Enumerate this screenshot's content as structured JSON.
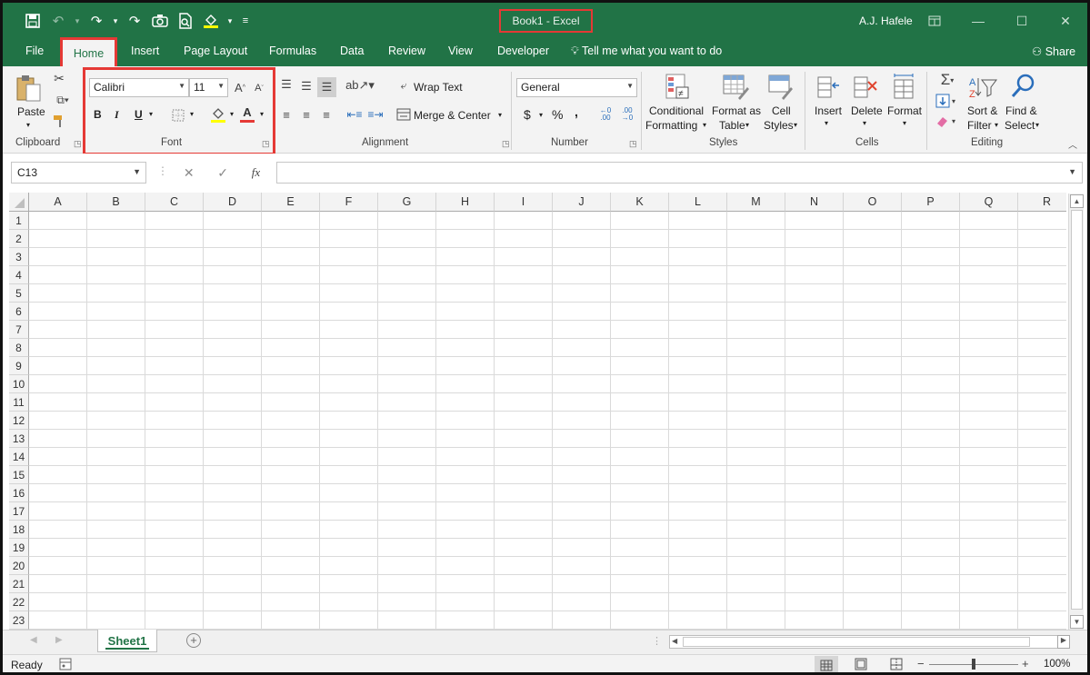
{
  "title_bar": {
    "window_title": "Book1  -  Excel",
    "user_name": "A.J. Hafele",
    "qat_icons": [
      "save-icon",
      "undo-icon",
      "redo-icon",
      "redo-icon",
      "camera-icon",
      "print-preview-icon",
      "fill-color-icon",
      "customize-qat-icon"
    ],
    "window_buttons": [
      "ribbon-display-icon",
      "minimize-icon",
      "maximize-icon",
      "close-icon"
    ]
  },
  "tabs": {
    "items": [
      "File",
      "Home",
      "Insert",
      "Page Layout",
      "Formulas",
      "Data",
      "Review",
      "View",
      "Developer"
    ],
    "active": "Home",
    "tell_me": "Tell me what you want to do",
    "share": "Share"
  },
  "ribbon": {
    "clipboard": {
      "label": "Clipboard",
      "paste": "Paste"
    },
    "font": {
      "label": "Font",
      "font_name": "Calibri",
      "font_size": "11",
      "bold": "B",
      "italic": "I",
      "underline": "U",
      "font_color_glyph": "A"
    },
    "alignment": {
      "label": "Alignment",
      "wrap_text": "Wrap Text",
      "merge_center": "Merge & Center"
    },
    "number": {
      "label": "Number",
      "format": "General",
      "currency": "$",
      "percent": "%",
      "comma": ","
    },
    "styles": {
      "label": "Styles",
      "conditional_1": "Conditional",
      "conditional_2": "Formatting",
      "format_as_1": "Format as",
      "format_as_2": "Table",
      "cell_styles_1": "Cell",
      "cell_styles_2": "Styles"
    },
    "cells": {
      "label": "Cells",
      "insert": "Insert",
      "delete": "Delete",
      "format": "Format"
    },
    "editing": {
      "label": "Editing",
      "sort_1": "Sort &",
      "sort_2": "Filter",
      "find_1": "Find &",
      "find_2": "Select"
    }
  },
  "formula_bar": {
    "name_box": "C13",
    "fx": "fx",
    "value": ""
  },
  "grid": {
    "columns": [
      "A",
      "B",
      "C",
      "D",
      "E",
      "F",
      "G",
      "H",
      "I",
      "J",
      "K",
      "L",
      "M",
      "N",
      "O",
      "P",
      "Q",
      "R"
    ],
    "rows": [
      "1",
      "2",
      "3",
      "4",
      "5",
      "6",
      "7",
      "8",
      "9",
      "10",
      "11",
      "12",
      "13",
      "14",
      "15",
      "16",
      "17",
      "18",
      "19",
      "20",
      "21",
      "22",
      "23"
    ]
  },
  "sheets": {
    "items": [
      "Sheet1"
    ],
    "active": "Sheet1"
  },
  "status_bar": {
    "ready": "Ready",
    "zoom": "100%"
  },
  "colors": {
    "excel_green": "#217346",
    "highlight_red": "#e53935"
  }
}
